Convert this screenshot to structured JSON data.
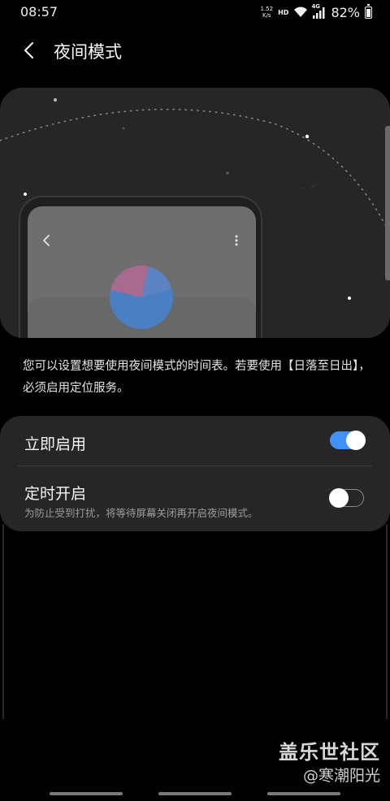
{
  "status_bar": {
    "time": "08:57",
    "speed_value": "1.52",
    "speed_unit": "K/s",
    "hd": "HD",
    "network": "4G",
    "battery": "82%"
  },
  "header": {
    "title": "夜间模式"
  },
  "description": "您可以设置想要使用夜间模式的时间表。若要使用【日落至日出】，必须启用定位服务。",
  "settings": {
    "turn_on_now": {
      "label": "立即启用",
      "enabled": true
    },
    "scheduled": {
      "label": "定时开启",
      "sub": "为防止受到打扰，将等待屏幕关闭再开启夜间模式。",
      "enabled": false
    }
  },
  "colors": {
    "accent": "#3e91ff",
    "moon": "#f5c518",
    "card": "#262626"
  },
  "watermark": {
    "title": "盖乐世社区",
    "user": "@寒潮阳光"
  }
}
